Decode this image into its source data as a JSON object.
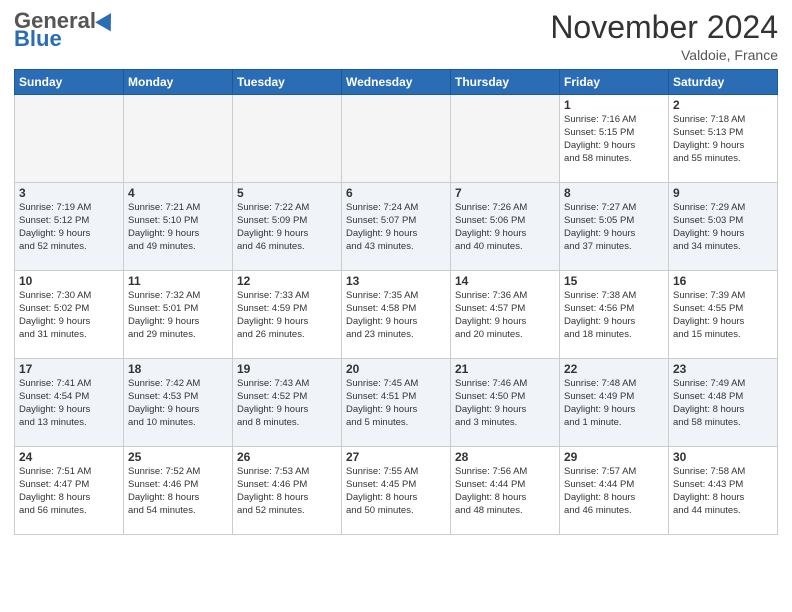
{
  "header": {
    "logo_general": "General",
    "logo_blue": "Blue",
    "month": "November 2024",
    "location": "Valdoie, France"
  },
  "weekdays": [
    "Sunday",
    "Monday",
    "Tuesday",
    "Wednesday",
    "Thursday",
    "Friday",
    "Saturday"
  ],
  "weeks": [
    [
      {
        "day": "",
        "info": ""
      },
      {
        "day": "",
        "info": ""
      },
      {
        "day": "",
        "info": ""
      },
      {
        "day": "",
        "info": ""
      },
      {
        "day": "",
        "info": ""
      },
      {
        "day": "1",
        "info": "Sunrise: 7:16 AM\nSunset: 5:15 PM\nDaylight: 9 hours\nand 58 minutes."
      },
      {
        "day": "2",
        "info": "Sunrise: 7:18 AM\nSunset: 5:13 PM\nDaylight: 9 hours\nand 55 minutes."
      }
    ],
    [
      {
        "day": "3",
        "info": "Sunrise: 7:19 AM\nSunset: 5:12 PM\nDaylight: 9 hours\nand 52 minutes."
      },
      {
        "day": "4",
        "info": "Sunrise: 7:21 AM\nSunset: 5:10 PM\nDaylight: 9 hours\nand 49 minutes."
      },
      {
        "day": "5",
        "info": "Sunrise: 7:22 AM\nSunset: 5:09 PM\nDaylight: 9 hours\nand 46 minutes."
      },
      {
        "day": "6",
        "info": "Sunrise: 7:24 AM\nSunset: 5:07 PM\nDaylight: 9 hours\nand 43 minutes."
      },
      {
        "day": "7",
        "info": "Sunrise: 7:26 AM\nSunset: 5:06 PM\nDaylight: 9 hours\nand 40 minutes."
      },
      {
        "day": "8",
        "info": "Sunrise: 7:27 AM\nSunset: 5:05 PM\nDaylight: 9 hours\nand 37 minutes."
      },
      {
        "day": "9",
        "info": "Sunrise: 7:29 AM\nSunset: 5:03 PM\nDaylight: 9 hours\nand 34 minutes."
      }
    ],
    [
      {
        "day": "10",
        "info": "Sunrise: 7:30 AM\nSunset: 5:02 PM\nDaylight: 9 hours\nand 31 minutes."
      },
      {
        "day": "11",
        "info": "Sunrise: 7:32 AM\nSunset: 5:01 PM\nDaylight: 9 hours\nand 29 minutes."
      },
      {
        "day": "12",
        "info": "Sunrise: 7:33 AM\nSunset: 4:59 PM\nDaylight: 9 hours\nand 26 minutes."
      },
      {
        "day": "13",
        "info": "Sunrise: 7:35 AM\nSunset: 4:58 PM\nDaylight: 9 hours\nand 23 minutes."
      },
      {
        "day": "14",
        "info": "Sunrise: 7:36 AM\nSunset: 4:57 PM\nDaylight: 9 hours\nand 20 minutes."
      },
      {
        "day": "15",
        "info": "Sunrise: 7:38 AM\nSunset: 4:56 PM\nDaylight: 9 hours\nand 18 minutes."
      },
      {
        "day": "16",
        "info": "Sunrise: 7:39 AM\nSunset: 4:55 PM\nDaylight: 9 hours\nand 15 minutes."
      }
    ],
    [
      {
        "day": "17",
        "info": "Sunrise: 7:41 AM\nSunset: 4:54 PM\nDaylight: 9 hours\nand 13 minutes."
      },
      {
        "day": "18",
        "info": "Sunrise: 7:42 AM\nSunset: 4:53 PM\nDaylight: 9 hours\nand 10 minutes."
      },
      {
        "day": "19",
        "info": "Sunrise: 7:43 AM\nSunset: 4:52 PM\nDaylight: 9 hours\nand 8 minutes."
      },
      {
        "day": "20",
        "info": "Sunrise: 7:45 AM\nSunset: 4:51 PM\nDaylight: 9 hours\nand 5 minutes."
      },
      {
        "day": "21",
        "info": "Sunrise: 7:46 AM\nSunset: 4:50 PM\nDaylight: 9 hours\nand 3 minutes."
      },
      {
        "day": "22",
        "info": "Sunrise: 7:48 AM\nSunset: 4:49 PM\nDaylight: 9 hours\nand 1 minute."
      },
      {
        "day": "23",
        "info": "Sunrise: 7:49 AM\nSunset: 4:48 PM\nDaylight: 8 hours\nand 58 minutes."
      }
    ],
    [
      {
        "day": "24",
        "info": "Sunrise: 7:51 AM\nSunset: 4:47 PM\nDaylight: 8 hours\nand 56 minutes."
      },
      {
        "day": "25",
        "info": "Sunrise: 7:52 AM\nSunset: 4:46 PM\nDaylight: 8 hours\nand 54 minutes."
      },
      {
        "day": "26",
        "info": "Sunrise: 7:53 AM\nSunset: 4:46 PM\nDaylight: 8 hours\nand 52 minutes."
      },
      {
        "day": "27",
        "info": "Sunrise: 7:55 AM\nSunset: 4:45 PM\nDaylight: 8 hours\nand 50 minutes."
      },
      {
        "day": "28",
        "info": "Sunrise: 7:56 AM\nSunset: 4:44 PM\nDaylight: 8 hours\nand 48 minutes."
      },
      {
        "day": "29",
        "info": "Sunrise: 7:57 AM\nSunset: 4:44 PM\nDaylight: 8 hours\nand 46 minutes."
      },
      {
        "day": "30",
        "info": "Sunrise: 7:58 AM\nSunset: 4:43 PM\nDaylight: 8 hours\nand 44 minutes."
      }
    ]
  ]
}
